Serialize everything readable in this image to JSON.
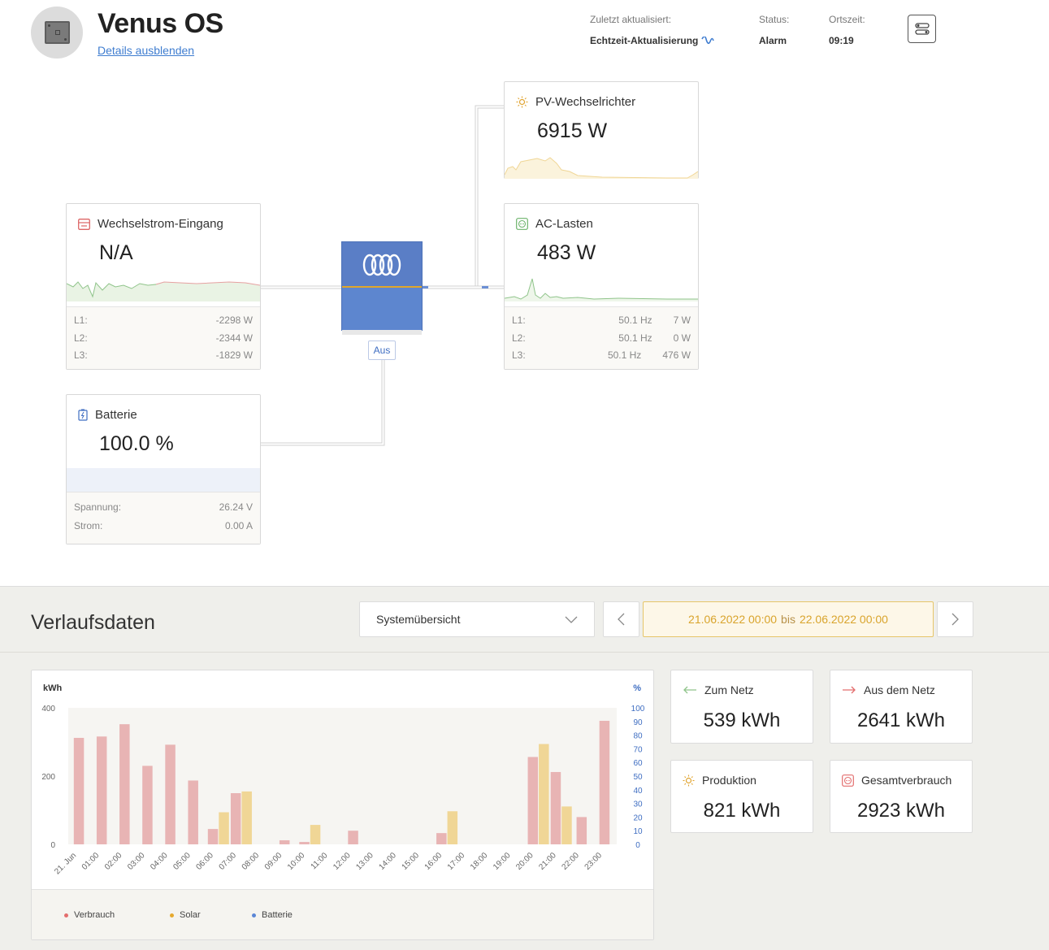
{
  "header": {
    "title": "Venus OS",
    "details_link": "Details ausblenden",
    "last_update_label": "Zuletzt aktualisiert:",
    "last_update_value": "Echtzeit-Aktualisierung",
    "status_label": "Status:",
    "status_value": "Alarm",
    "time_label": "Ortszeit:",
    "time_value": "09:19"
  },
  "cards": {
    "ac_input": {
      "title": "Wechselstrom-Eingang",
      "value": "N/A",
      "rows": [
        {
          "phase": "L1:",
          "power": "-2298 W"
        },
        {
          "phase": "L2:",
          "power": "-2344 W"
        },
        {
          "phase": "L3:",
          "power": "-1829 W"
        }
      ]
    },
    "battery": {
      "title": "Batterie",
      "value": "100.0 %",
      "rows": [
        {
          "label": "Spannung:",
          "value": "26.24 V"
        },
        {
          "label": "Strom:",
          "value": "0.00 A"
        }
      ]
    },
    "pv_inverter": {
      "title": "PV-Wechselrichter",
      "value": "6915 W"
    },
    "ac_loads": {
      "title": "AC-Lasten",
      "value": "483 W",
      "rows": [
        {
          "phase": "L1:",
          "freq": "50.1 Hz",
          "power": "7 W"
        },
        {
          "phase": "L2:",
          "freq": "50.1 Hz",
          "power": "0 W"
        },
        {
          "phase": "L3:",
          "freq": "50.1 Hz",
          "power": "476 W"
        }
      ]
    }
  },
  "inverter": {
    "mode_badge": "Aus"
  },
  "history": {
    "title": "Verlaufsdaten",
    "select_value": "Systemübersicht",
    "range_from": "21.06.2022 00:00",
    "range_sep": "bis",
    "range_to": "22.06.2022 00:00"
  },
  "stats": {
    "to_grid": {
      "label": "Zum Netz",
      "value": "539 kWh"
    },
    "from_grid": {
      "label": "Aus dem Netz",
      "value": "2641 kWh"
    },
    "production": {
      "label": "Produktion",
      "value": "821 kWh"
    },
    "consumption": {
      "label": "Gesamtverbrauch",
      "value": "2923 kWh"
    }
  },
  "colors": {
    "consumption": "#e8b4b4",
    "solar": "#f0d696",
    "battery": "#6b8fd4",
    "accent_blue": "#3f7dd0",
    "accent_orange": "#d9a42c"
  },
  "chart_data": {
    "type": "bar",
    "y_left_label": "kWh",
    "y_right_label": "%",
    "ylim": [
      0,
      400
    ],
    "y2lim": [
      0,
      100
    ],
    "y_ticks": [
      "0",
      "200",
      "400"
    ],
    "y2_ticks": [
      "0",
      "10",
      "20",
      "30",
      "40",
      "50",
      "60",
      "70",
      "80",
      "90",
      "100"
    ],
    "categories": [
      "21. Jun",
      "01:00",
      "02:00",
      "03:00",
      "04:00",
      "05:00",
      "06:00",
      "07:00",
      "08:00",
      "09:00",
      "10:00",
      "11:00",
      "12:00",
      "13:00",
      "14:00",
      "15:00",
      "16:00",
      "17:00",
      "18:00",
      "19:00",
      "20:00",
      "21:00",
      "22:00",
      "23:00"
    ],
    "series": [
      {
        "name": "Verbrauch",
        "color": "#e8b4b4",
        "values": [
          312,
          316,
          352,
          230,
          292,
          187,
          45,
          150,
          0,
          12,
          7,
          0,
          40,
          0,
          0,
          0,
          33,
          0,
          0,
          0,
          256,
          212,
          80,
          362
        ]
      },
      {
        "name": "Solar",
        "color": "#f0d696",
        "values": [
          0,
          0,
          0,
          0,
          0,
          0,
          94,
          155,
          0,
          0,
          57,
          0,
          0,
          0,
          0,
          0,
          97,
          0,
          0,
          0,
          294,
          111,
          0,
          0
        ]
      },
      {
        "name": "Batterie",
        "color": "#6b8fd4",
        "values": [
          0,
          0,
          0,
          0,
          0,
          0,
          0,
          0,
          0,
          0,
          0,
          0,
          0,
          0,
          0,
          0,
          0,
          0,
          0,
          0,
          0,
          0,
          0,
          0
        ]
      }
    ],
    "legend_position": "bottom",
    "grid": false
  }
}
